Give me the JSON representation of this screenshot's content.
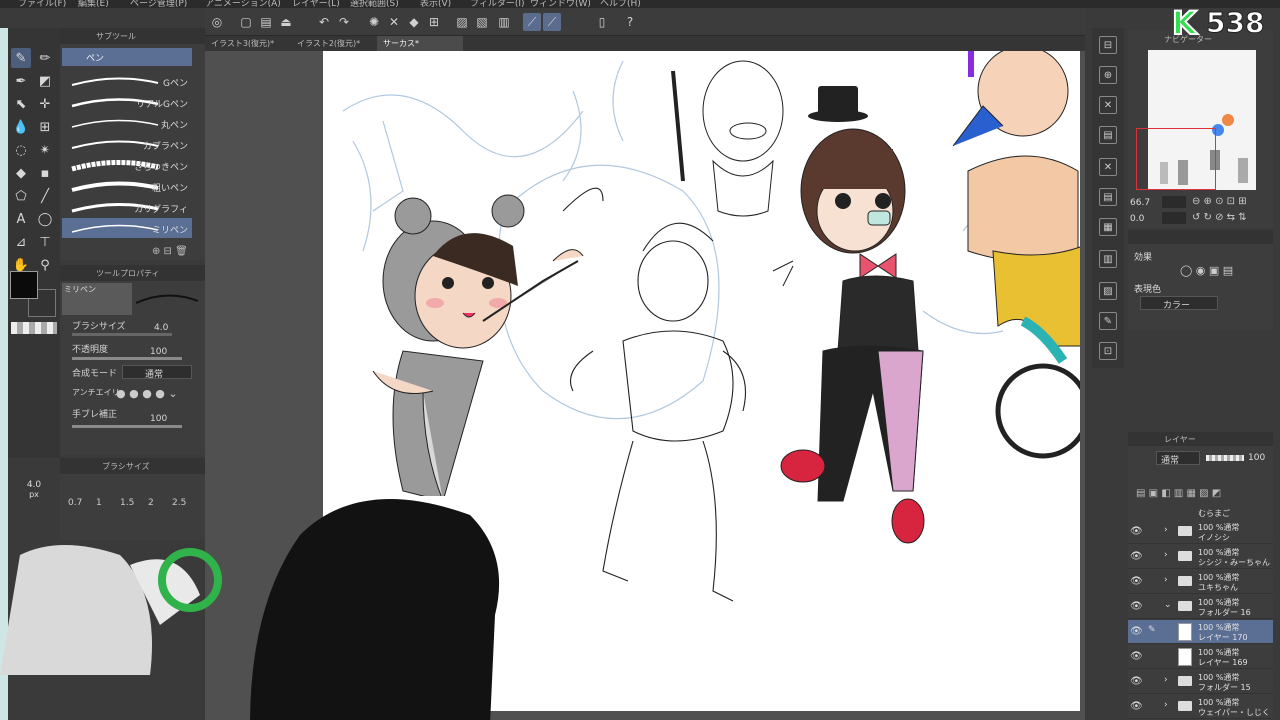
{
  "menu": [
    "ファイル(F)",
    "編集(E)",
    "ページ管理(P)",
    "アニメーション(A)",
    "レイヤー(L)",
    "選択範囲(S)",
    "表示(V)",
    "フィルター(I)",
    "ウィンドウ(W)",
    "ヘルプ(H)"
  ],
  "tabs": [
    {
      "label": "イラスト3(復元)*",
      "active": false
    },
    {
      "label": "イラスト2(復元)*",
      "active": false
    },
    {
      "label": "サーカス*",
      "active": true
    }
  ],
  "subtool": {
    "header": "サブツール",
    "active_group": "ペン",
    "brushes": [
      "Gペン",
      "リアルGペン",
      "丸ペン",
      "カブラペン",
      "さらつきペン",
      "粗いペン",
      "カリグラフィ",
      "ミリペン"
    ],
    "selected_brush": "ミリペン"
  },
  "toolprop": {
    "header": "ツールプロパティ",
    "preview_label": "ミリペン",
    "brush_size_label": "ブラシサイズ",
    "brush_size": "4.0",
    "opacity_label": "不透明度",
    "opacity": "100",
    "blend_label": "合成モード",
    "blend": "通常",
    "antialias_label": "アンチエイリ",
    "stabilize_label": "手ブレ補正",
    "stabilize": "100"
  },
  "brushsize_panel": {
    "header": "ブラシサイズ",
    "current": "4.0",
    "unit": "px",
    "ticks": [
      "0.7",
      "1",
      "1.5",
      "2",
      "2.5"
    ]
  },
  "navigator": {
    "header": "ナビゲーター",
    "zoom": "66.7",
    "rotation": "0.0"
  },
  "effects": {
    "header": "効果",
    "expression_label": "表現色",
    "expression": "カラー"
  },
  "layers": {
    "header": "レイヤー",
    "blend": "通常",
    "opacity": "100",
    "partial_row": "むらまご",
    "rows": [
      {
        "mode": "100 %通常",
        "name": "イノシシ",
        "type": "folder",
        "selected": false
      },
      {
        "mode": "100 %通常",
        "name": "シシジ・みーちゃん",
        "type": "folder",
        "selected": false
      },
      {
        "mode": "100 %通常",
        "name": "ユキちゃん",
        "type": "folder",
        "selected": false
      },
      {
        "mode": "100 %通常",
        "name": "フォルダー 16",
        "type": "folder",
        "selected": false
      },
      {
        "mode": "100 %通常",
        "name": "レイヤー 170",
        "type": "layer",
        "selected": true
      },
      {
        "mode": "100 %通常",
        "name": "レイヤー 169",
        "type": "layer",
        "selected": false
      },
      {
        "mode": "100 %通常",
        "name": "フォルダー 15",
        "type": "folder",
        "selected": false
      },
      {
        "mode": "100 %通常",
        "name": "ウェイパー・しじく",
        "type": "folder",
        "selected": false
      }
    ]
  },
  "overlay": {
    "logo_letter": "K",
    "logo_number": "538"
  },
  "colors": {
    "accent": "#5b6f95",
    "main_color": "#0b0b0b",
    "logo_green": "#2fe04a"
  }
}
